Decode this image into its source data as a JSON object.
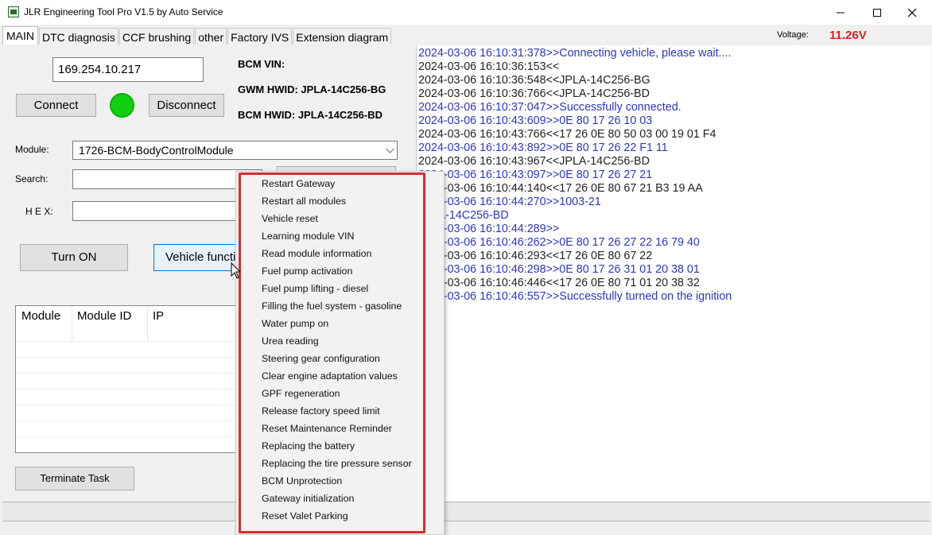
{
  "window": {
    "title": "JLR Engineering Tool Pro V1.5 by Auto Service"
  },
  "tabs": [
    {
      "label": "MAIN"
    },
    {
      "label": "DTC diagnosis"
    },
    {
      "label": "CCF brushing"
    },
    {
      "label": "other"
    },
    {
      "label": "Factory IVS"
    },
    {
      "label": "Extension diagram"
    }
  ],
  "voltage": {
    "label": "Voltage:",
    "value": "11.26V",
    "color": "#e02020"
  },
  "connection": {
    "ip_value": "169.254.10.217",
    "connect_label": "Connect",
    "disconnect_label": "Disconnect",
    "status_color": "#10d010"
  },
  "info": {
    "bcm_vin": "BCM VIN:",
    "gwm_hwid": "GWM HWID: JPLA-14C256-BG",
    "bcm_hwid": "BCM HWID: JPLA-14C256-BD"
  },
  "form": {
    "module_label": "Module:",
    "module_value": "1726-BCM-BodyControlModule",
    "search_label": "Search:",
    "hex_label": "H E X:"
  },
  "actions": {
    "turn_on_label": "Turn ON",
    "vehicle_functions_label": "Vehicle functions",
    "terminate_label": "Terminate Task"
  },
  "table": {
    "headers": [
      "Module",
      "Module ID",
      "IP"
    ]
  },
  "log": [
    {
      "text": "2024-03-06 16:10:31:378>>Connecting vehicle, please wait....",
      "dir": "out"
    },
    {
      "text": "2024-03-06 16:10:36:153<<",
      "dir": "in"
    },
    {
      "text": "2024-03-06 16:10:36:548<<JPLA-14C256-BG",
      "dir": "in"
    },
    {
      "text": "2024-03-06 16:10:36:766<<JPLA-14C256-BD",
      "dir": "in"
    },
    {
      "text": "2024-03-06 16:10:37:047>>Successfully connected.",
      "dir": "out"
    },
    {
      "text": "2024-03-06 16:10:43:609>>0E 80 17 26 10 03",
      "dir": "out"
    },
    {
      "text": "2024-03-06 16:10:43:766<<17 26 0E 80 50 03 00 19 01 F4",
      "dir": "in"
    },
    {
      "text": "2024-03-06 16:10:43:892>>0E 80 17 26 22 F1 11",
      "dir": "out"
    },
    {
      "text": "2024-03-06 16:10:43:967<<JPLA-14C256-BD",
      "dir": "in"
    },
    {
      "text": "2024-03-06 16:10:43:097>>0E 80 17 26 27 21",
      "dir": "out"
    },
    {
      "text": "2024-03-06 16:10:44:140<<17 26 0E 80 67 21 B3 19 AA",
      "dir": "in"
    },
    {
      "text": "2024-03-06 16:10:44:270>>1003-21",
      "dir": "out"
    },
    {
      "text": "JPLA-14C256-BD",
      "dir": "out"
    },
    {
      "text": "2024-03-06 16:10:44:289>>",
      "dir": "out"
    },
    {
      "text": "2024-03-06 16:10:46:262>>0E 80 17 26 27 22 16 79 40",
      "dir": "out"
    },
    {
      "text": "2024-03-06 16:10:46:293<<17 26 0E 80 67 22",
      "dir": "in"
    },
    {
      "text": "2024-03-06 16:10:46:298>>0E 80 17 26 31 01 20 38 01",
      "dir": "out"
    },
    {
      "text": "2024-03-06 16:10:46:446<<17 26 0E 80 71 01 20 38 32",
      "dir": "in"
    },
    {
      "text": "2024-03-06 16:10:46:557>>Successfully turned on the ignition",
      "dir": "out"
    }
  ],
  "context_menu": {
    "items": [
      "Restart Gateway",
      "Restart all modules",
      "Vehicle reset",
      "Learning module VIN",
      "Read module information",
      "Fuel pump activation",
      "Fuel pump lifting - diesel",
      "Filling the fuel system - gasoline",
      "Water pump on",
      "Urea reading",
      "Steering gear configuration",
      "Clear engine adaptation values",
      "GPF regeneration",
      "Release factory speed limit",
      "Reset Maintenance Reminder",
      "Replacing the battery",
      "Replacing the tire pressure sensor",
      "BCM Unprotection",
      "Gateway initialization",
      "Reset Valet Parking"
    ],
    "highlight_color": "#d92c2c"
  }
}
